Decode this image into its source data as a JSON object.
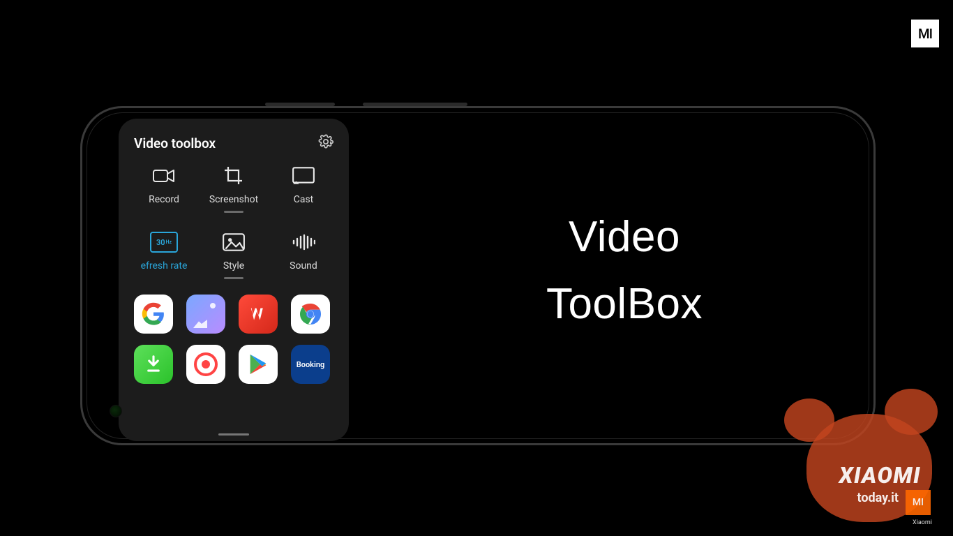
{
  "brand_logo": "MI",
  "phone_screen": {
    "toolbox": {
      "title": "Video toolbox",
      "settings_icon": "gear-icon",
      "tools": [
        {
          "name": "record",
          "label": "Record",
          "icon": "camcorder-icon",
          "active": false,
          "has_indicator": false
        },
        {
          "name": "screenshot",
          "label": "Screenshot",
          "icon": "crop-icon",
          "active": false,
          "has_indicator": true
        },
        {
          "name": "cast",
          "label": "Cast",
          "icon": "cast-icon",
          "active": false,
          "has_indicator": false
        },
        {
          "name": "refresh-rate",
          "label": "efresh rate",
          "icon": "refresh-30",
          "active": true,
          "has_indicator": false,
          "badge_value": "30",
          "badge_unit": "Hz"
        },
        {
          "name": "style",
          "label": "Style",
          "icon": "image-icon",
          "active": false,
          "has_indicator": true
        },
        {
          "name": "sound",
          "label": "Sound",
          "icon": "equalizer-icon",
          "active": false,
          "has_indicator": false
        }
      ],
      "apps": [
        {
          "name": "google",
          "label": "Google"
        },
        {
          "name": "gallery",
          "label": "Gallery"
        },
        {
          "name": "wps",
          "label": "WPS Office",
          "glyph": "W"
        },
        {
          "name": "chrome",
          "label": "Chrome"
        },
        {
          "name": "download",
          "label": "Downloads"
        },
        {
          "name": "recorder",
          "label": "Screen Recorder"
        },
        {
          "name": "play",
          "label": "Play Store"
        },
        {
          "name": "booking",
          "label": "Booking",
          "glyph": "Booking"
        }
      ]
    }
  },
  "slide_title_line1": "Video",
  "slide_title_line2": "ToolBox",
  "watermark": {
    "brand": "XIAOMI",
    "site": "today.it",
    "mi": "MI",
    "company": "Xiaomi"
  }
}
